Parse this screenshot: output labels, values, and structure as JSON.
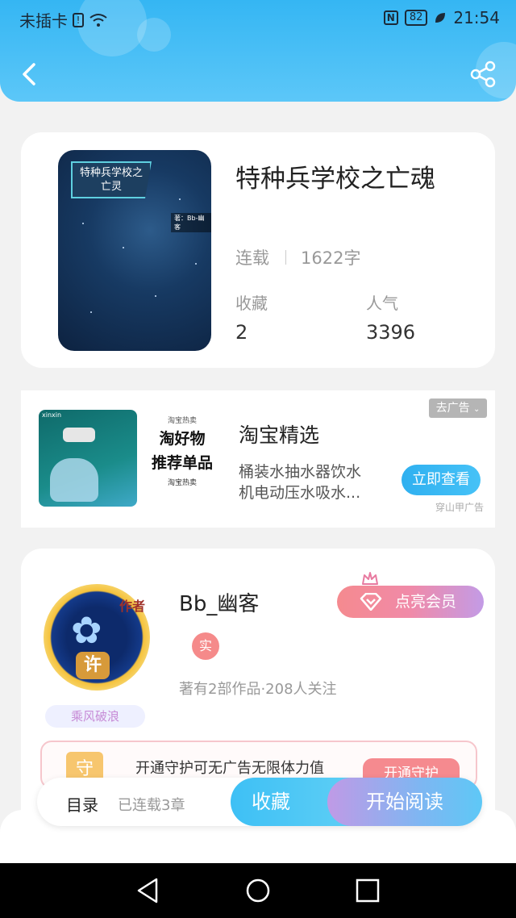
{
  "status_bar": {
    "carrier": "未插卡",
    "battery": "82",
    "time": "21:54"
  },
  "icons": {
    "back": "back-arrow-icon",
    "share": "share-icon"
  },
  "book": {
    "cover_title": "特种兵学校之亡灵",
    "cover_author": "著：Bb-幽客",
    "title": "特种兵学校之亡魂",
    "status": "连载",
    "word_count": "1622字",
    "collect_label": "收藏",
    "collect_value": "2",
    "popularity_label": "人气",
    "popularity_value": "3396"
  },
  "ad": {
    "brand": "xinxin",
    "promo_small": "淘宝热卖",
    "promo_big_1": "淘好物",
    "promo_big_2": "推荐单品",
    "promo_small_2": "淘宝热卖",
    "title": "淘宝精选",
    "description": "桶装水抽水器饮水机电动压水吸水...",
    "button": "立即查看",
    "close_label": "去广告",
    "source": "穿山甲广告"
  },
  "author": {
    "avatar_tag": "作者",
    "avatar_badge": "许",
    "name": "Bb_幽客",
    "real_badge": "实",
    "meta": "著有2部作品·208人关注",
    "style_tag": "乘风破浪",
    "vip_button": "点亮会员",
    "guard_icon_text": "守",
    "guard_text": "开通守护可无广告无限体力值",
    "guard_button": "开通守护"
  },
  "action_bar": {
    "toc_label": "目录",
    "toc_count": "已连载3章",
    "collect_button": "收藏",
    "read_button": "开始阅读"
  }
}
